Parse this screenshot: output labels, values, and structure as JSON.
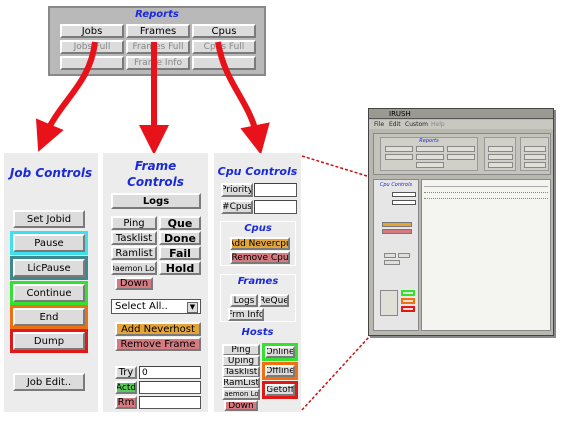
{
  "reports": {
    "title": "Reports",
    "row1": [
      "Jobs",
      "Frames",
      "Cpus"
    ],
    "row2": [
      "Jobs Full",
      "Frames Full",
      "Cpus Full"
    ],
    "row3": [
      "Frame Info"
    ]
  },
  "job_controls": {
    "title": "Job Controls",
    "buttons": [
      "Set Jobid",
      "Pause",
      "LicPause",
      "Continue",
      "End",
      "Dump",
      "Job Edit.."
    ]
  },
  "frame_controls": {
    "title_line1": "Frame",
    "title_line2": "Controls",
    "logs": "Logs",
    "left_buttons": [
      "Ping",
      "Tasklist",
      "Ramlist",
      "Daemon Log",
      "Down"
    ],
    "status_labels": [
      "Que",
      "Done",
      "Fail",
      "Hold"
    ],
    "select_value": "Select All..",
    "add_neverhost": "Add Neverhost",
    "remove_frame": "Remove Frame",
    "try_label": "Try",
    "try_value": "0",
    "actd_label": "Actd",
    "rm_label": "Rm"
  },
  "cpu_controls": {
    "title": "Cpu Controls",
    "priority_label": "Priority",
    "cpus_label": "#Cpus",
    "cpus_section": "Cpus",
    "add_nevercpu": "Add Nevercpu",
    "remove_cpu": "Remove Cpu",
    "frames_section": "Frames",
    "logs": "Logs",
    "reque": "ReQue",
    "frm_info": "Frm Info",
    "hosts_section": "Hosts",
    "host_left": [
      "Ping",
      "Uping",
      "Tasklist",
      "RamList",
      "Daemon Log",
      "Down"
    ],
    "host_right": [
      "Online",
      "Offline",
      "Getoff"
    ]
  },
  "mini_window": {
    "title": "IRUSH",
    "menu": [
      "File",
      "Edit",
      "Custom",
      "Help"
    ]
  },
  "colors": {
    "title_blue": "#1a2ad8",
    "arrow_red": "#e8121a",
    "pause_ring": "#3ee0f0",
    "licpause_ring": "#3a8a90",
    "continue_ring": "#34e030",
    "end_ring": "#f07010",
    "dump_ring": "#e01818"
  }
}
